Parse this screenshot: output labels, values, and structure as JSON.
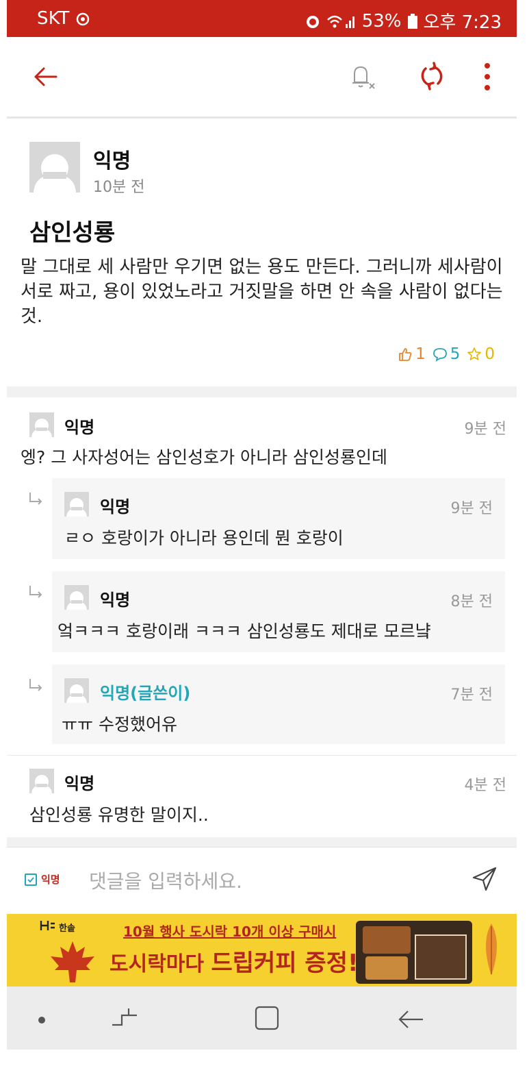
{
  "status_bar": {
    "carrier": "SKT",
    "battery": "53%",
    "time": "오후 7:23"
  },
  "post": {
    "author": "익명",
    "time": "10분 전",
    "title": "삼인성룡",
    "body": "말 그대로 세 사람만 우기면 없는 용도 만든다. 그러니까 세사람이 서로 짜고, 용이 있었노라고 거짓말을 하면 안 속을 사람이 없다는 것.",
    "likes": "1",
    "comments": "5",
    "scraps": "0"
  },
  "comments": [
    {
      "author": "익명",
      "time": "9분 전",
      "text": "엥? 그 사자성어는 삼인성호가 아니라 삼인성룡인데",
      "replies": [
        {
          "author": "익명",
          "time": "9분 전",
          "text": "ㄹㅇ 호랑이가 아니라 용인데 뭔 호랑이"
        },
        {
          "author": "익명",
          "time": "8분 전",
          "text": "엌ㅋㅋㅋ 호랑이래 ㅋㅋㅋ 삼인성룡도 제대로 모르냨"
        },
        {
          "author": "익명(글쓴이)",
          "time": "7분 전",
          "text": "ㅠㅠ 수정했어유"
        }
      ]
    },
    {
      "author": "익명",
      "time": "4분 전",
      "text": "삼인성룡 유명한 말이지.."
    }
  ],
  "comment_input": {
    "anon_label": "익명",
    "placeholder": "댓글을 입력하세요."
  },
  "ad": {
    "brand": "한솥",
    "line1": "10월 행사 도시락 10개 이상 구매시",
    "line2_prefix": "도시락마다 ",
    "line2_highlight": "드립커피 증정!"
  },
  "colors": {
    "accent": "#c62418",
    "teal": "#23a6b8",
    "orange": "#e8852a",
    "star": "#e8b400"
  }
}
